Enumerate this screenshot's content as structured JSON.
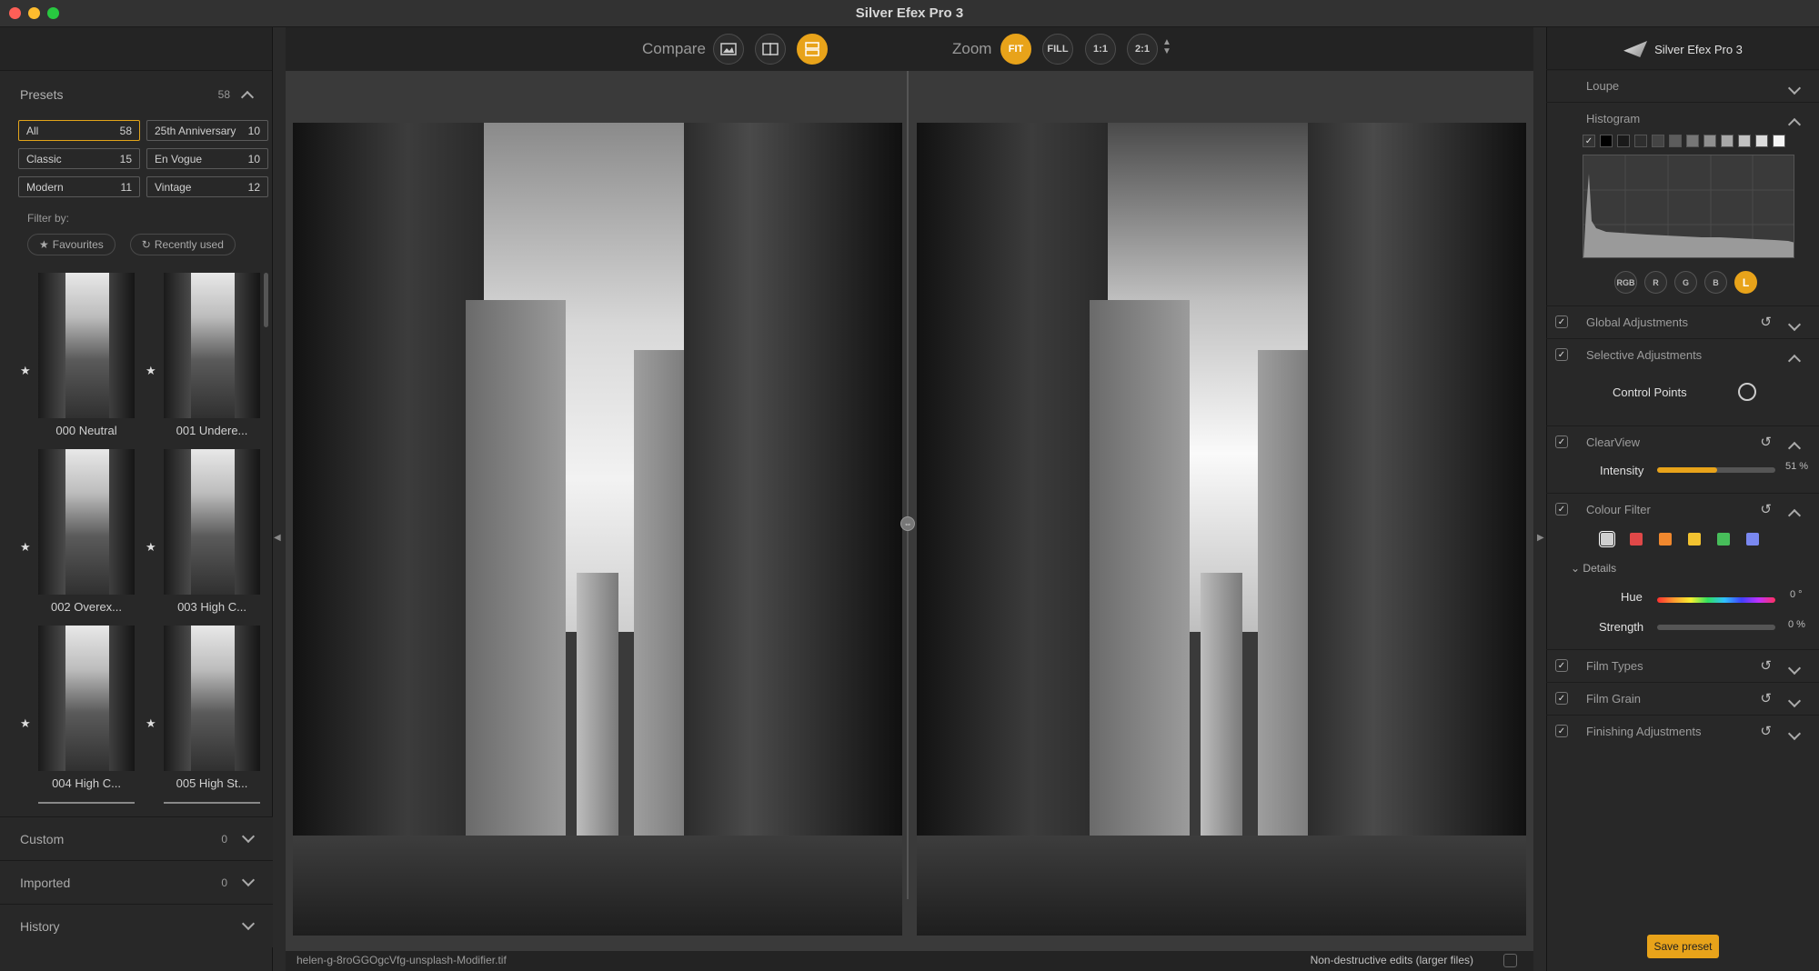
{
  "window": {
    "title": "Silver Efex Pro 3"
  },
  "left_panel": {
    "presets": {
      "label": "Presets",
      "count": "58"
    },
    "categories": [
      {
        "label": "All",
        "count": "58",
        "active": true
      },
      {
        "label": "25th Anniversary",
        "count": "10"
      },
      {
        "label": "Classic",
        "count": "15"
      },
      {
        "label": "En Vogue",
        "count": "10"
      },
      {
        "label": "Modern",
        "count": "11"
      },
      {
        "label": "Vintage",
        "count": "12"
      }
    ],
    "filter_by": "Filter by:",
    "chips": [
      {
        "label": "Favourites",
        "icon": "star-icon"
      },
      {
        "label": "Recently used",
        "icon": "history-icon"
      }
    ],
    "thumbnails": [
      {
        "label": "000 Neutral"
      },
      {
        "label": "001 Undere..."
      },
      {
        "label": "002 Overex..."
      },
      {
        "label": "003 High C..."
      },
      {
        "label": "004 High C..."
      },
      {
        "label": "005 High St..."
      }
    ],
    "sections": [
      {
        "label": "Custom",
        "count": "0"
      },
      {
        "label": "Imported",
        "count": "0"
      },
      {
        "label": "History",
        "count": ""
      }
    ]
  },
  "toolbar": {
    "compare_label": "Compare",
    "zoom_label": "Zoom",
    "zoom_options": [
      "FIT",
      "FILL",
      "1:1",
      "2:1"
    ],
    "zoom_active": "FIT"
  },
  "status": {
    "filename": "helen-g-8roGGOgcVfg-unsplash-Modifier.tif",
    "non_destructive": "Non-destructive edits (larger files)"
  },
  "right_panel": {
    "brand": "Silver Efex Pro 3",
    "loupe": "Loupe",
    "histogram": "Histogram",
    "channels": [
      "RGB",
      "R",
      "G",
      "B",
      "L"
    ],
    "channel_active": "L",
    "global_adjustments": "Global Adjustments",
    "selective_adjustments": "Selective Adjustments",
    "control_points": "Control Points",
    "clearview": "ClearView",
    "intensity": {
      "label": "Intensity",
      "value": "51 %",
      "fraction": 0.51
    },
    "colour_filter": "Colour Filter",
    "filter_colors": [
      "#cfcfcf",
      "#e04848",
      "#f0882e",
      "#f2c230",
      "#47bd5a",
      "#7a88f0"
    ],
    "details": "Details",
    "hue": {
      "label": "Hue",
      "value": "0 °"
    },
    "strength": {
      "label": "Strength",
      "value": "0 %"
    },
    "film_types": "Film Types",
    "film_grain": "Film Grain",
    "finishing_adjustments": "Finishing Adjustments",
    "save_preset": "Save preset"
  },
  "colors": {
    "accent": "#e8a31a"
  }
}
